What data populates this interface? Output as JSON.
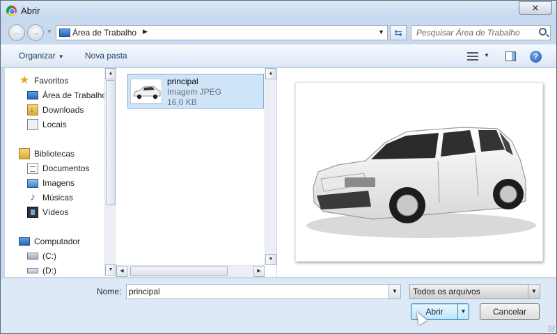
{
  "window": {
    "title": "Abrir",
    "close_label": "✕"
  },
  "nav": {
    "back_glyph": "←",
    "forward_glyph": "→",
    "address": "Área de Trabalho",
    "search_placeholder": "Pesquisar Área de Trabalho"
  },
  "toolbar": {
    "organizar": "Organizar",
    "nova_pasta": "Nova pasta"
  },
  "sidebar": {
    "favoritos": "Favoritos",
    "area_trabalho": "Área de Trabalho",
    "downloads": "Downloads",
    "locais": "Locais",
    "bibliotecas": "Bibliotecas",
    "documentos": "Documentos",
    "imagens": "Imagens",
    "musicas": "Músicas",
    "videos": "Vídeos",
    "computador": "Computador",
    "drive_c": "(C:)",
    "drive_d": "(D:)"
  },
  "files": [
    {
      "name": "principal",
      "type": "Imagem JPEG",
      "size": "16,0 KB"
    }
  ],
  "bottom": {
    "name_label": "Nome:",
    "name_value": "principal",
    "filter": "Todos os arquivos",
    "open_button": "Abrir",
    "cancel_button": "Cancelar"
  },
  "colors": {
    "selection": "#cde4f9",
    "frame": "#c9d9ee",
    "accent": "#2f6fba"
  },
  "icons": [
    "chrome-icon",
    "back-icon",
    "forward-icon",
    "desktop-icon",
    "refresh-icon",
    "search-icon",
    "view-icon",
    "preview-pane-icon",
    "help-icon",
    "star-icon",
    "downloads-icon",
    "recent-places-icon",
    "library-icon",
    "documents-icon",
    "pictures-icon",
    "music-icon",
    "videos-icon",
    "computer-icon",
    "drive-icon"
  ]
}
